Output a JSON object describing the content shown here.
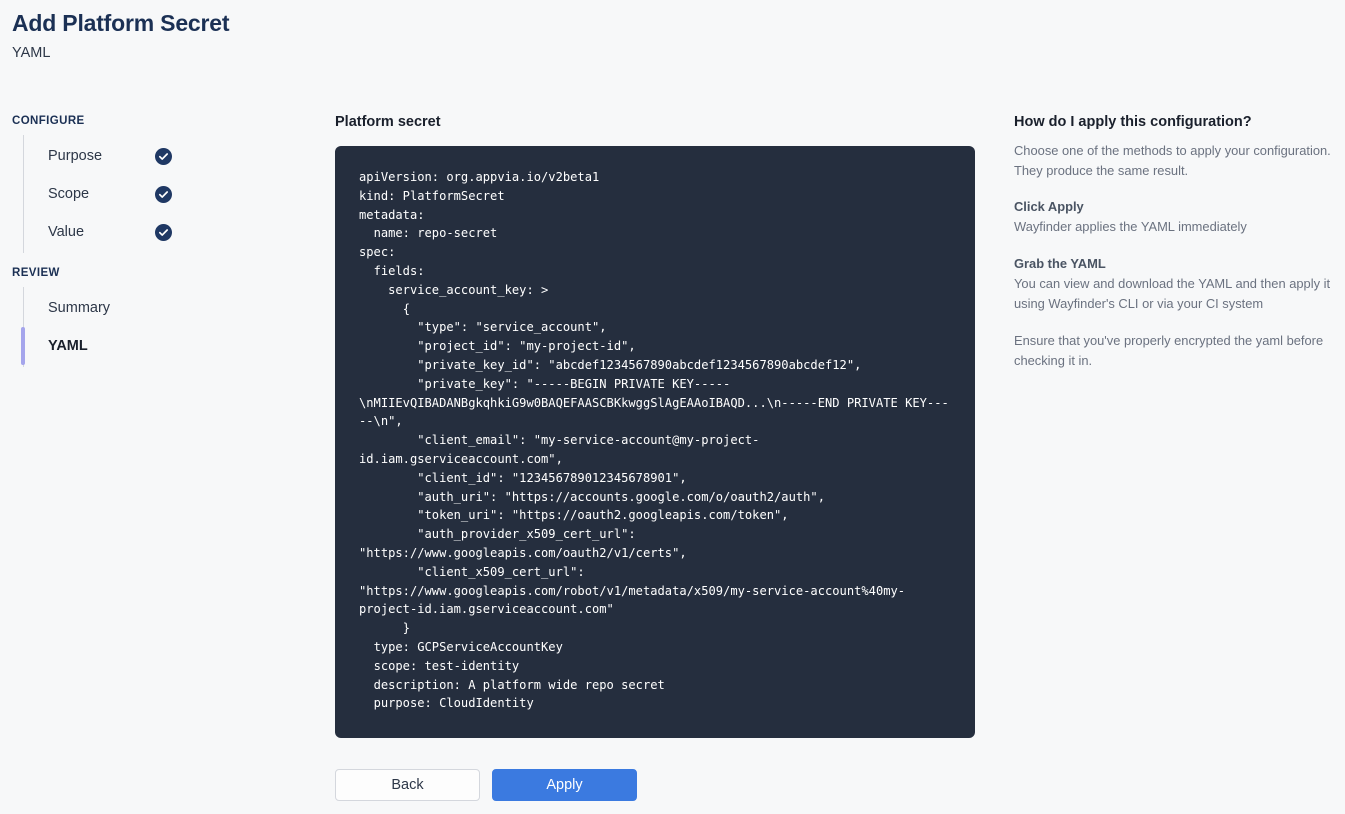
{
  "header": {
    "title": "Add Platform Secret",
    "subtitle": "YAML"
  },
  "sidebar": {
    "configure_label": "CONFIGURE",
    "review_label": "REVIEW",
    "configure_items": [
      {
        "label": "Purpose",
        "completed": true
      },
      {
        "label": "Scope",
        "completed": true
      },
      {
        "label": "Value",
        "completed": true
      }
    ],
    "review_items": [
      {
        "label": "Summary",
        "active": false
      },
      {
        "label": "YAML",
        "active": true
      }
    ]
  },
  "main": {
    "section_label": "Platform secret",
    "yaml": "apiVersion: org.appvia.io/v2beta1\nkind: PlatformSecret\nmetadata:\n  name: repo-secret\nspec:\n  fields:\n    service_account_key: >\n      {\n        \"type\": \"service_account\",\n        \"project_id\": \"my-project-id\",\n        \"private_key_id\": \"abcdef1234567890abcdef1234567890abcdef12\",\n        \"private_key\": \"-----BEGIN PRIVATE KEY-----\\nMIIEvQIBADANBgkqhkiG9w0BAQEFAASCBKkwggSlAgEAAoIBAQD...\\n-----END PRIVATE KEY-----\\n\",\n        \"client_email\": \"my-service-account@my-project-id.iam.gserviceaccount.com\",\n        \"client_id\": \"123456789012345678901\",\n        \"auth_uri\": \"https://accounts.google.com/o/oauth2/auth\",\n        \"token_uri\": \"https://oauth2.googleapis.com/token\",\n        \"auth_provider_x509_cert_url\": \"https://www.googleapis.com/oauth2/v1/certs\",\n        \"client_x509_cert_url\": \"https://www.googleapis.com/robot/v1/metadata/x509/my-service-account%40my-project-id.iam.gserviceaccount.com\"\n      }\n  type: GCPServiceAccountKey\n  scope: test-identity\n  description: A platform wide repo secret\n  purpose: CloudIdentity"
  },
  "actions": {
    "back_label": "Back",
    "apply_label": "Apply"
  },
  "help": {
    "title": "How do I apply this configuration?",
    "intro": "Choose one of the methods to apply your configuration. They produce the same result.",
    "sections": [
      {
        "heading": "Click Apply",
        "text": "Wayfinder applies the YAML immediately"
      },
      {
        "heading": "Grab the YAML",
        "text": "You can view and download the YAML and then apply it using Wayfinder's CLI or via your CI system"
      }
    ],
    "footer": "Ensure that you've properly encrypted the yaml before checking it in."
  },
  "colors": {
    "page_background": "#f7f8f9",
    "title": "#1b3054",
    "code_background": "#252e3e",
    "check_badge": "#1f3864",
    "active_indicator": "#a5a5ec",
    "primary_button": "#3b7ae0"
  }
}
